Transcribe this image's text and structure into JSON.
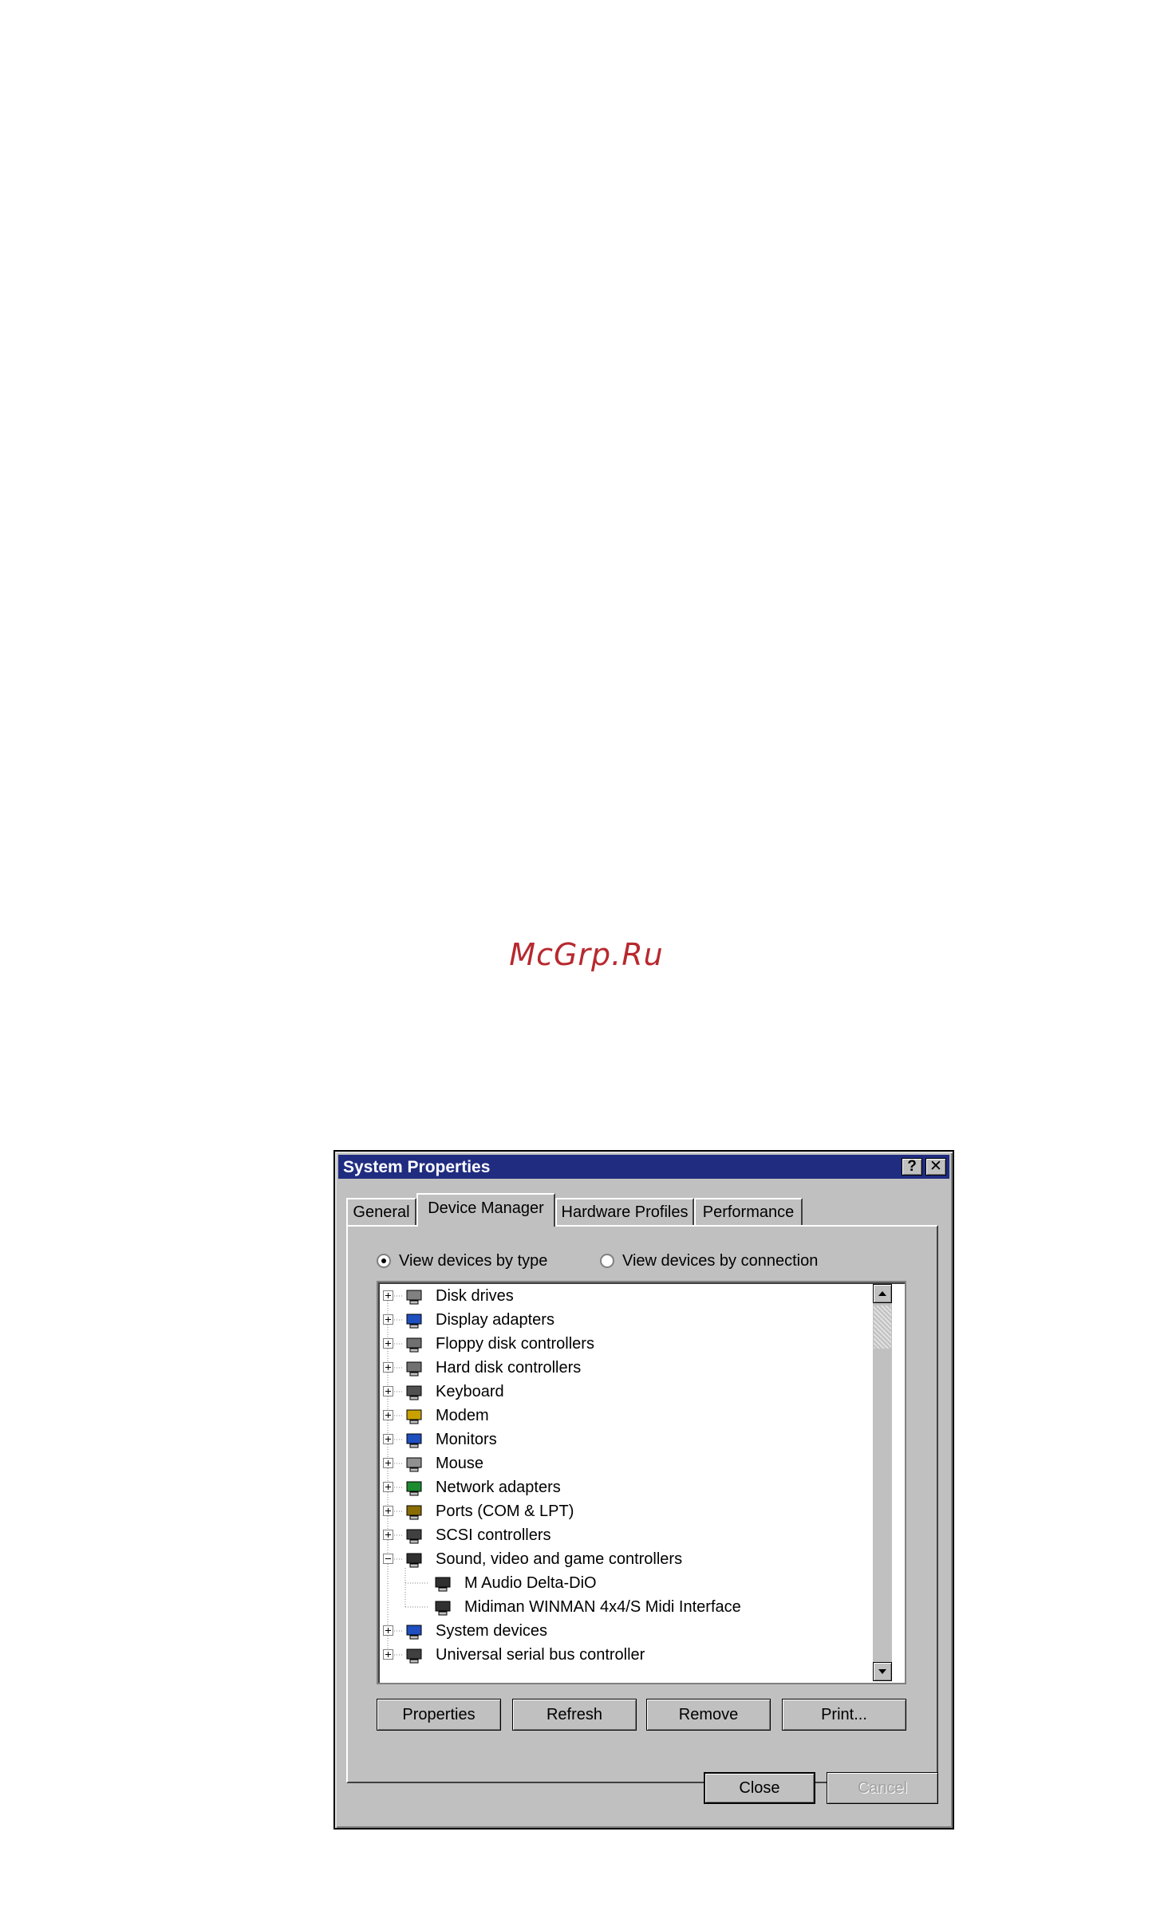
{
  "watermark": "McGrp.Ru",
  "window": {
    "title": "System Properties",
    "help_label": "?",
    "close_label": "✕"
  },
  "tabs": [
    {
      "label": "General"
    },
    {
      "label": "Device Manager"
    },
    {
      "label": "Hardware Profiles"
    },
    {
      "label": "Performance"
    }
  ],
  "view_options": {
    "by_type": "View devices by type",
    "by_connection": "View devices by connection",
    "selected": "View devices by type"
  },
  "devices": [
    {
      "label": "Disk drives",
      "icon": "disk-drive-icon"
    },
    {
      "label": "Display adapters",
      "icon": "display-adapter-icon"
    },
    {
      "label": "Floppy disk controllers",
      "icon": "floppy-controller-icon"
    },
    {
      "label": "Hard disk controllers",
      "icon": "hard-disk-controller-icon"
    },
    {
      "label": "Keyboard",
      "icon": "keyboard-icon"
    },
    {
      "label": "Modem",
      "icon": "modem-icon"
    },
    {
      "label": "Monitors",
      "icon": "monitor-icon"
    },
    {
      "label": "Mouse",
      "icon": "mouse-icon"
    },
    {
      "label": "Network adapters",
      "icon": "network-adapter-icon"
    },
    {
      "label": "Ports (COM & LPT)",
      "icon": "port-icon"
    },
    {
      "label": "SCSI controllers",
      "icon": "scsi-controller-icon"
    },
    {
      "label": "Sound, video and game controllers",
      "icon": "sound-controller-icon",
      "expanded": true
    },
    {
      "label": "M Audio Delta-DiO",
      "icon": "sound-device-icon",
      "child": true
    },
    {
      "label": "Midiman WINMAN 4x4/S Midi Interface",
      "icon": "sound-device-icon",
      "child": true
    },
    {
      "label": "System devices",
      "icon": "system-device-icon"
    },
    {
      "label": "Universal serial bus controller",
      "icon": "usb-controller-icon"
    }
  ],
  "buttons": {
    "properties": "Properties",
    "refresh": "Refresh",
    "remove": "Remove",
    "print": "Print...",
    "close": "Close",
    "cancel": "Cancel"
  },
  "colors": {
    "titlebar": "#1f2c80",
    "face": "#c0c0c0",
    "watermark": "#b7292f"
  }
}
